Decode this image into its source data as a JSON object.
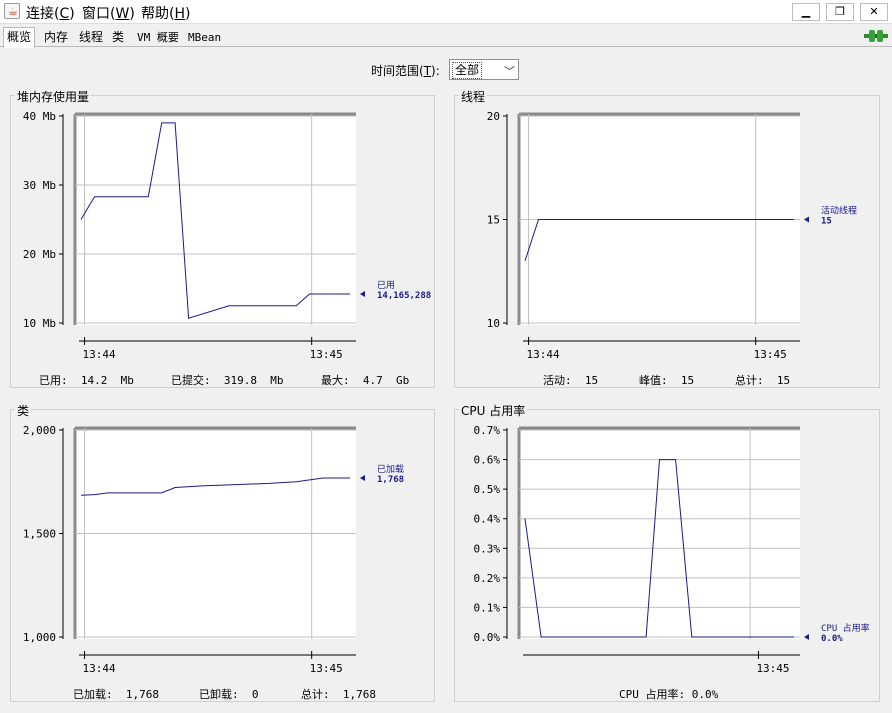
{
  "menubar": {
    "app_icon": "java-cup-icon",
    "items": [
      {
        "label": "连接(",
        "key": "C",
        "end": ")"
      },
      {
        "label": "窗口(",
        "key": "W",
        "end": ")"
      },
      {
        "label": "帮助(",
        "key": "H",
        "end": ")"
      }
    ],
    "window_buttons": [
      "minimize-icon",
      "restore-icon",
      "close-icon"
    ]
  },
  "tabs": [
    "概览",
    "内存",
    "线程",
    "类",
    "VM 概要",
    "MBean"
  ],
  "active_tab": 0,
  "connection_icon": "connected-plug-icon",
  "time_range": {
    "label": "时间范围(",
    "key": "T",
    "end": "):",
    "value": "全部"
  },
  "colors": {
    "series": "#1a1a8c",
    "grid": "#c0c0c0",
    "border": "#d0d0d0"
  },
  "chart_data": [
    {
      "type": "line",
      "title": "堆内存使用量",
      "y_ticks": [
        "40 Mb",
        "30 Mb",
        "20 Mb",
        "10 Mb"
      ],
      "ylim": [
        10,
        40
      ],
      "x_ticks": [
        "13:44",
        "13:45"
      ],
      "x": [
        0,
        0.05,
        0.2,
        0.25,
        0.3,
        0.35,
        0.4,
        0.55,
        0.8,
        0.85,
        1.0
      ],
      "series": [
        {
          "name": "已用",
          "values": [
            25,
            28.3,
            28.3,
            28.3,
            39,
            39,
            10.7,
            12.5,
            12.5,
            14.2,
            14.2
          ]
        }
      ],
      "legend_value": "14,165,288",
      "stats": [
        {
          "label": "已用:",
          "value": "14.2  Mb"
        },
        {
          "label": "已提交:",
          "value": "319.8  Mb"
        },
        {
          "label": "最大:",
          "value": "4.7  Gb"
        }
      ]
    },
    {
      "type": "line",
      "title": "线程",
      "y_ticks": [
        "20",
        "15",
        "10"
      ],
      "ylim": [
        10,
        20
      ],
      "x_ticks": [
        "13:44",
        "13:45"
      ],
      "x": [
        0,
        0.05,
        1.0
      ],
      "series": [
        {
          "name": "活动线程",
          "values": [
            13,
            15,
            15
          ]
        }
      ],
      "legend_value": "15",
      "stats": [
        {
          "label": "活动:",
          "value": "15"
        },
        {
          "label": "峰值:",
          "value": "15"
        },
        {
          "label": "总计:",
          "value": "15"
        }
      ]
    },
    {
      "type": "line",
      "title": "类",
      "y_ticks": [
        "2,000",
        "1,500",
        "1,000"
      ],
      "ylim": [
        1000,
        2000
      ],
      "x_ticks": [
        "13:44",
        "13:45"
      ],
      "x": [
        0,
        0.05,
        0.1,
        0.3,
        0.35,
        0.45,
        0.55,
        0.7,
        0.8,
        0.9,
        1.0
      ],
      "series": [
        {
          "name": "已加载",
          "values": [
            1685,
            1688,
            1696,
            1696,
            1722,
            1730,
            1735,
            1742,
            1750,
            1768,
            1768
          ]
        }
      ],
      "legend_value": "1,768",
      "stats": [
        {
          "label": "已加载:",
          "value": "1,768"
        },
        {
          "label": "已卸载:",
          "value": "0"
        },
        {
          "label": "总计:",
          "value": "1,768"
        }
      ]
    },
    {
      "type": "line",
      "title": "CPU 占用率",
      "y_ticks": [
        "0.7%",
        "0.6%",
        "0.5%",
        "0.4%",
        "0.3%",
        "0.2%",
        "0.1%",
        "0.0%"
      ],
      "ylim": [
        0,
        0.7
      ],
      "x_ticks": [
        "13:45"
      ],
      "x": [
        0,
        0.06,
        0.45,
        0.5,
        0.56,
        0.62,
        1.0
      ],
      "series": [
        {
          "name": "CPU 占用率",
          "values": [
            0.4,
            0.0,
            0.0,
            0.6,
            0.6,
            0.0,
            0.0
          ]
        }
      ],
      "legend_value": "0.0%",
      "stats": [
        {
          "label": "CPU 占用率:",
          "value": "0.0%"
        }
      ]
    }
  ]
}
